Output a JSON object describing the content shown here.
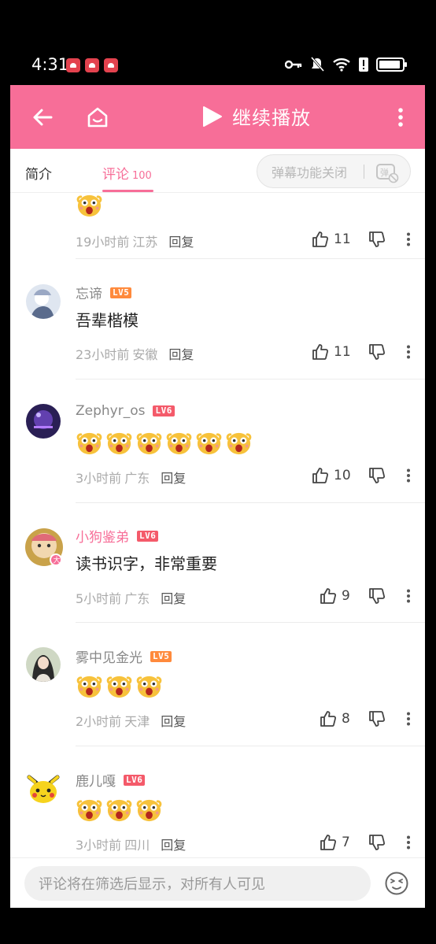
{
  "status_bar": {
    "time": "4:31",
    "notification_icons": [
      "app-notification-icon",
      "app-notification-icon",
      "app-notification-icon"
    ],
    "system_icons": [
      "key-icon",
      "mute-icon",
      "wifi-icon",
      "alert-icon",
      "battery-icon"
    ]
  },
  "top_bar": {
    "background": "#f76e98",
    "back_icon": "back-arrow-icon",
    "home_icon": "home-icon",
    "play_label": "继续播放",
    "more_icon": "more-vertical-icon"
  },
  "tabs": {
    "intro_label": "简介",
    "comments_label": "评论",
    "comments_count": "100",
    "danmaku_label": "弹幕功能关闭",
    "danmaku_icon_text": "弹"
  },
  "comments": [
    {
      "partial": true,
      "emoji_count": 1,
      "time": "19小时前",
      "location": "江苏",
      "reply": "回复",
      "likes": "11"
    },
    {
      "user": "忘谛",
      "level": "LV5",
      "text": "吾辈楷模",
      "time": "23小时前",
      "location": "安徽",
      "reply": "回复",
      "likes": "11"
    },
    {
      "user": "Zephyr_os",
      "level": "LV6",
      "emoji_count": 6,
      "time": "3小时前",
      "location": "广东",
      "reply": "回复",
      "likes": "10"
    },
    {
      "user": "小狗鉴弟",
      "level": "LV6",
      "vip": true,
      "text": "读书识字，非常重要",
      "time": "5小时前",
      "location": "广东",
      "reply": "回复",
      "likes": "9"
    },
    {
      "user": "雾中见金光",
      "level": "LV5",
      "emoji_count": 3,
      "time": "2小时前",
      "location": "天津",
      "reply": "回复",
      "likes": "8"
    },
    {
      "user": "鹿儿嘎",
      "level": "LV6",
      "emoji_count": 3,
      "time": "3小时前",
      "location": "四川",
      "reply": "回复",
      "likes": "7"
    }
  ],
  "bottom_bar": {
    "placeholder": "评论将在筛选后显示，对所有人可见",
    "emoji_icon": "emoji-face-icon"
  }
}
